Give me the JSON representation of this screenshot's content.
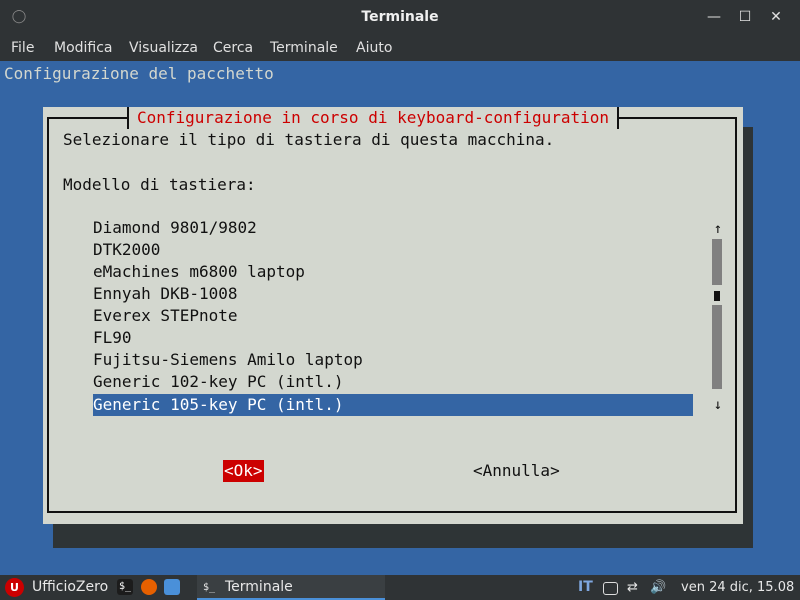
{
  "window": {
    "title": "Terminale",
    "left_icon": "◯",
    "minimize_glyph": "—",
    "maximize_glyph": "☐",
    "close_glyph": "✕"
  },
  "menu": {
    "items": [
      "File",
      "Modifica",
      "Visualizza",
      "Cerca",
      "Terminale",
      "Aiuto"
    ]
  },
  "terminal": {
    "header": "Configurazione del pacchetto",
    "dialog": {
      "title": "Configurazione in corso di keyboard-configuration",
      "prompt": "Selezionare il tipo di tastiera di questa macchina.",
      "label": "Modello di tastiera:",
      "items": [
        "Diamond 9801/9802",
        "DTK2000",
        "eMachines m6800 laptop",
        "Ennyah DKB-1008",
        "Everex STEPnote",
        "FL90",
        "Fujitsu-Siemens Amilo laptop",
        "Generic 102-key PC (intl.)",
        "Generic 105-key PC (intl.)"
      ],
      "selected_index": 8,
      "scroll_up": "↑",
      "scroll_down": "↓",
      "ok_label": "<Ok>",
      "cancel_label": "<Annulla>"
    }
  },
  "taskbar": {
    "start_label": "UfficioZero",
    "start_icon": "U",
    "terminal_launcher_glyph": "$_",
    "task_label": "Terminale",
    "task_glyph": "$_",
    "keyboard_layout": "IT",
    "clock": "ven 24 dic, 15.08",
    "icons": [
      "image-icon",
      "volume-icon",
      "network-icon",
      "power-icon"
    ]
  },
  "colors": {
    "terminal_bg": "#3465a4",
    "dialog_bg": "#d3d7cf",
    "dialog_title": "#cc0000",
    "selection": "#3465a4",
    "ok_bg": "#cc0000"
  }
}
